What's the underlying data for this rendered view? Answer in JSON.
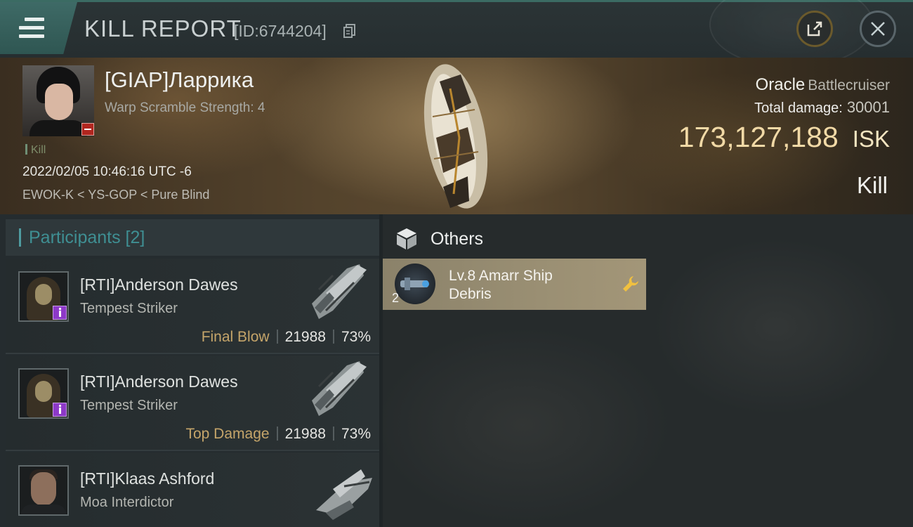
{
  "header": {
    "title": "KILL REPORT",
    "report_id": "[ID:6744204]"
  },
  "victim": {
    "name": "[GIAP]Ларрика",
    "warp_scramble": "Warp Scramble Strength: 4",
    "tag": "Kill",
    "datetime": "2022/02/05 10:46:16 UTC -6",
    "location": "EWOK-K < YS-GOP < Pure Blind",
    "ship_name": "Oracle",
    "ship_class": "Battlecruiser",
    "total_damage_label": "Total damage:",
    "total_damage": "30001",
    "isk_value": "173,127,188",
    "isk_unit": "ISK",
    "result": "Kill"
  },
  "participants": {
    "label": "Participants [2]",
    "rows": [
      {
        "name": "[RTI]Anderson Dawes",
        "ship": "Tempest Striker",
        "role": "Final Blow",
        "damage": "21988",
        "percent": "73%"
      },
      {
        "name": "[RTI]Anderson Dawes",
        "ship": "Tempest Striker",
        "role": "Top Damage",
        "damage": "21988",
        "percent": "73%"
      },
      {
        "name": "[RTI]Klaas Ashford",
        "ship": "Moa Interdictor"
      }
    ]
  },
  "others": {
    "label": "Others",
    "items": [
      {
        "name": "Lv.8 Amarr Ship Debris",
        "quantity": "2"
      }
    ]
  },
  "colors": {
    "accent_teal": "#3f8f93",
    "isk_gold": "#f1d9a6",
    "role_gold": "#c5a56a",
    "item_card": "#9a8f73"
  }
}
